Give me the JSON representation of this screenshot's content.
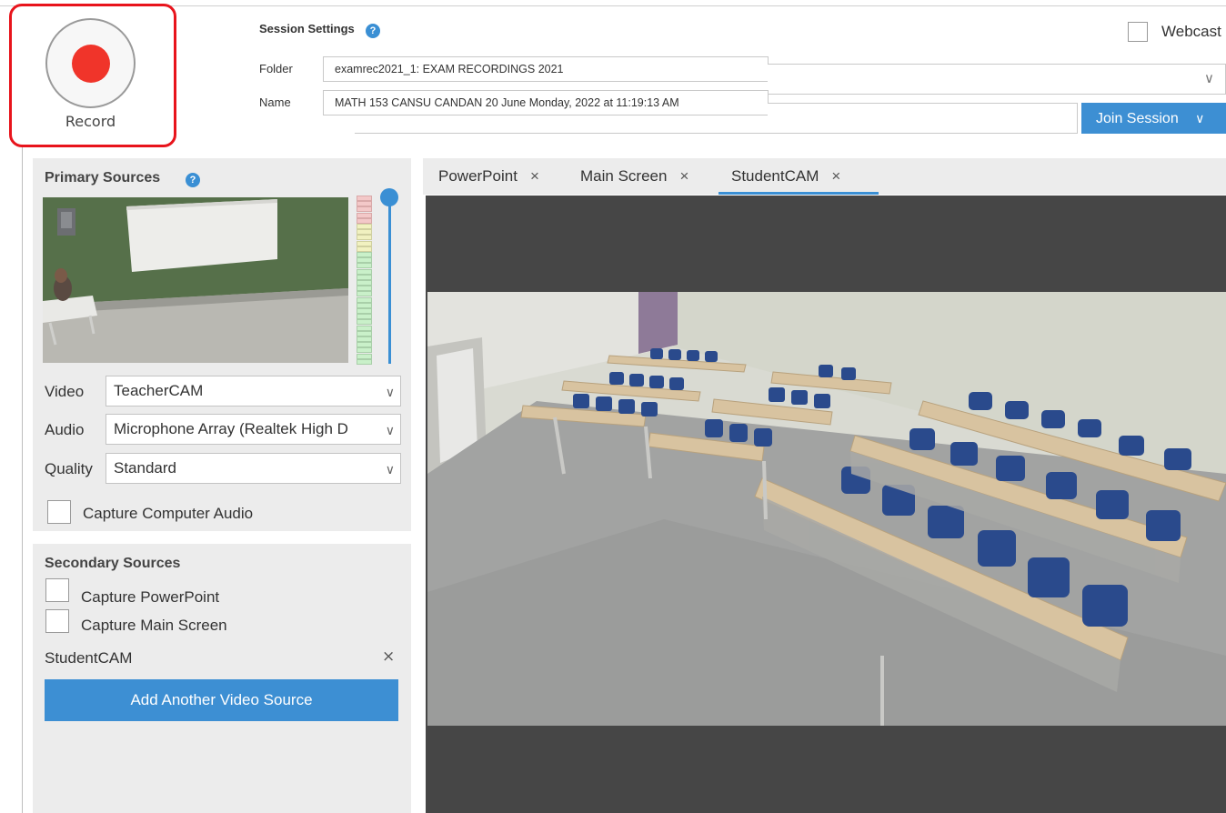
{
  "record": {
    "label": "Record"
  },
  "session": {
    "title": "Session Settings",
    "help_glyph": "?",
    "folder_label": "Folder",
    "folder_value": "examrec2021_1: EXAM RECORDINGS 2021",
    "name_label": "Name",
    "name_value": "MATH 153 CANSU CANDAN 20 June Monday,  2022 at 11:19:13 AM"
  },
  "webcast": {
    "label": "Webcast"
  },
  "join": {
    "label": "Join Session",
    "chevron": "∨"
  },
  "primary": {
    "title": "Primary Sources",
    "video_label": "Video",
    "video_value": "TeacherCAM",
    "audio_label": "Audio",
    "audio_value": "Microphone Array (Realtek High D",
    "quality_label": "Quality",
    "quality_value": "Standard",
    "capture_audio_label": "Capture Computer Audio"
  },
  "secondary": {
    "title": "Secondary Sources",
    "capture_ppt_label": "Capture PowerPoint",
    "capture_screen_label": "Capture Main Screen",
    "student_cam_label": "StudentCAM",
    "remove_glyph": "×",
    "add_source_label": "Add Another Video Source"
  },
  "tabs": [
    {
      "label": "PowerPoint",
      "active": false
    },
    {
      "label": "Main Screen",
      "active": false
    },
    {
      "label": "StudentCAM",
      "active": true
    }
  ],
  "tab_close_glyph": "×",
  "chevron_glyph": "∨",
  "colors": {
    "accent": "#3a8fd4",
    "record_red": "#f0342a",
    "highlight_red": "#e8141c",
    "panel_bg": "#ececec",
    "viewer_bg": "#464646"
  },
  "icons": {
    "help": "help-icon",
    "chevron": "chevron-down-icon",
    "close": "close-icon",
    "record": "record-icon"
  }
}
